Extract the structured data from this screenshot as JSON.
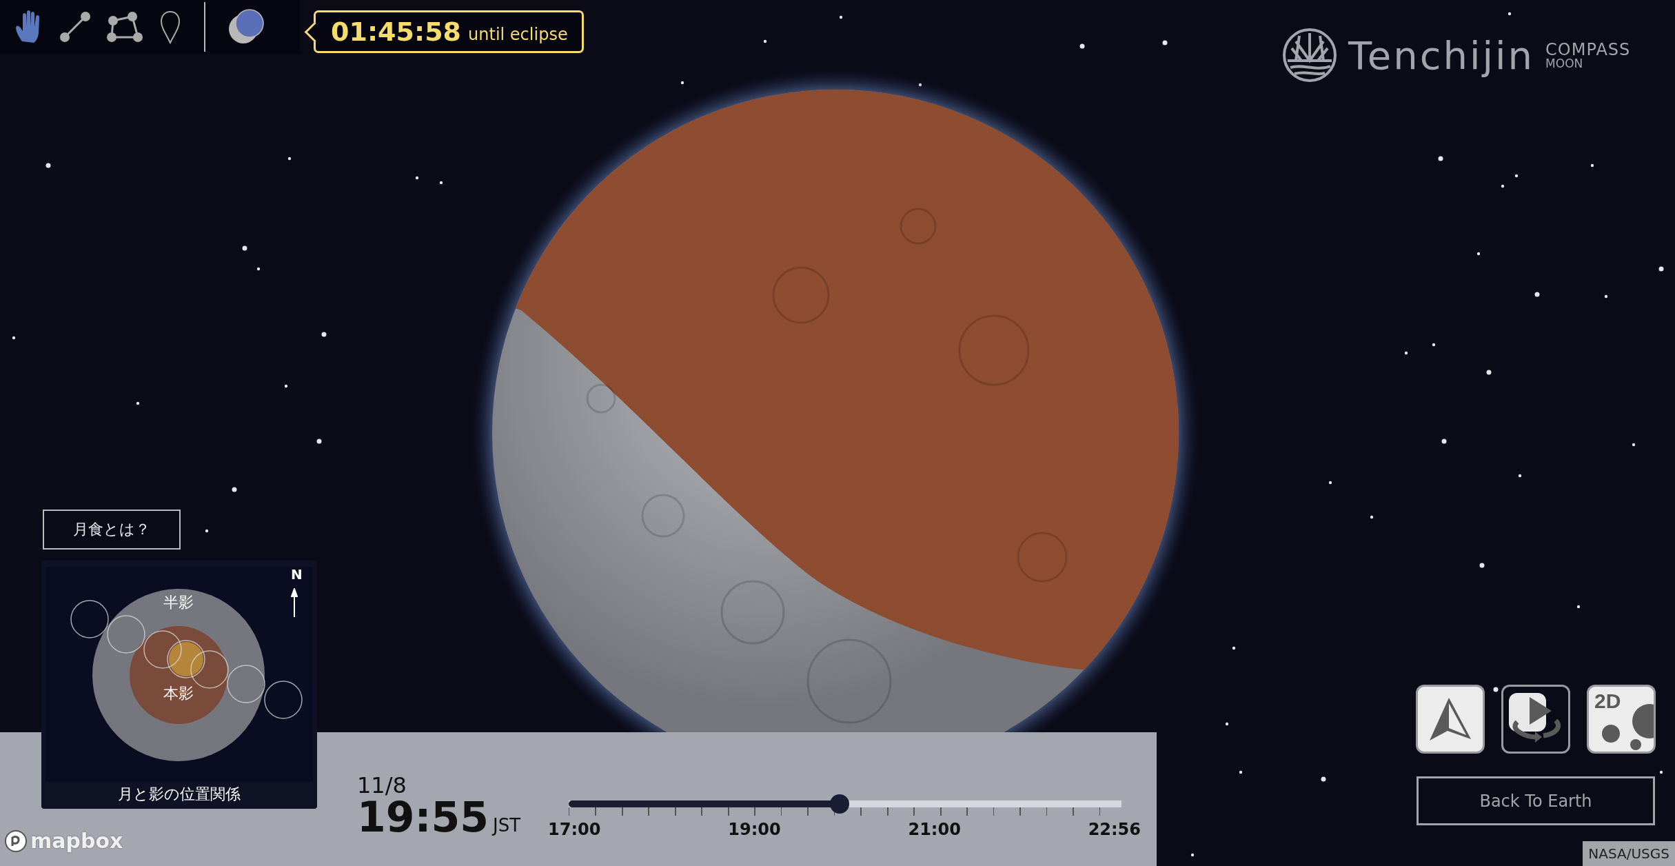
{
  "toolbar": {
    "tools": [
      {
        "kind": "hand",
        "selected": true
      },
      {
        "kind": "line",
        "selected": false
      },
      {
        "kind": "polygon",
        "selected": false
      },
      {
        "kind": "pin",
        "selected": false
      }
    ],
    "eclipse_toggle": {
      "on": true
    }
  },
  "countdown": {
    "time": "01:45:58",
    "label": "until eclipse"
  },
  "logo": {
    "name": "Tenchijin",
    "line1": "COMPASS",
    "line2": "MOON"
  },
  "help_button": "月食とは？",
  "diagram": {
    "penumbra_label": "半影",
    "umbra_label": "本影",
    "north": "N",
    "caption": "月と影の位置関係"
  },
  "clock": {
    "date": "11/8",
    "time": "19:55",
    "zone": "JST"
  },
  "timeline": {
    "level": 0.49,
    "labels": [
      "17:00",
      "19:00",
      "21:00",
      "22:56"
    ]
  },
  "view_buttons": [
    {
      "kind": "north",
      "selected": true
    },
    {
      "kind": "rotate",
      "selected": false
    },
    {
      "kind": "mode2d",
      "selected": true,
      "label": "2D"
    }
  ],
  "back_button": "Back To Earth",
  "mapbox": "mapbox",
  "attribution": "NASA/USGS"
}
